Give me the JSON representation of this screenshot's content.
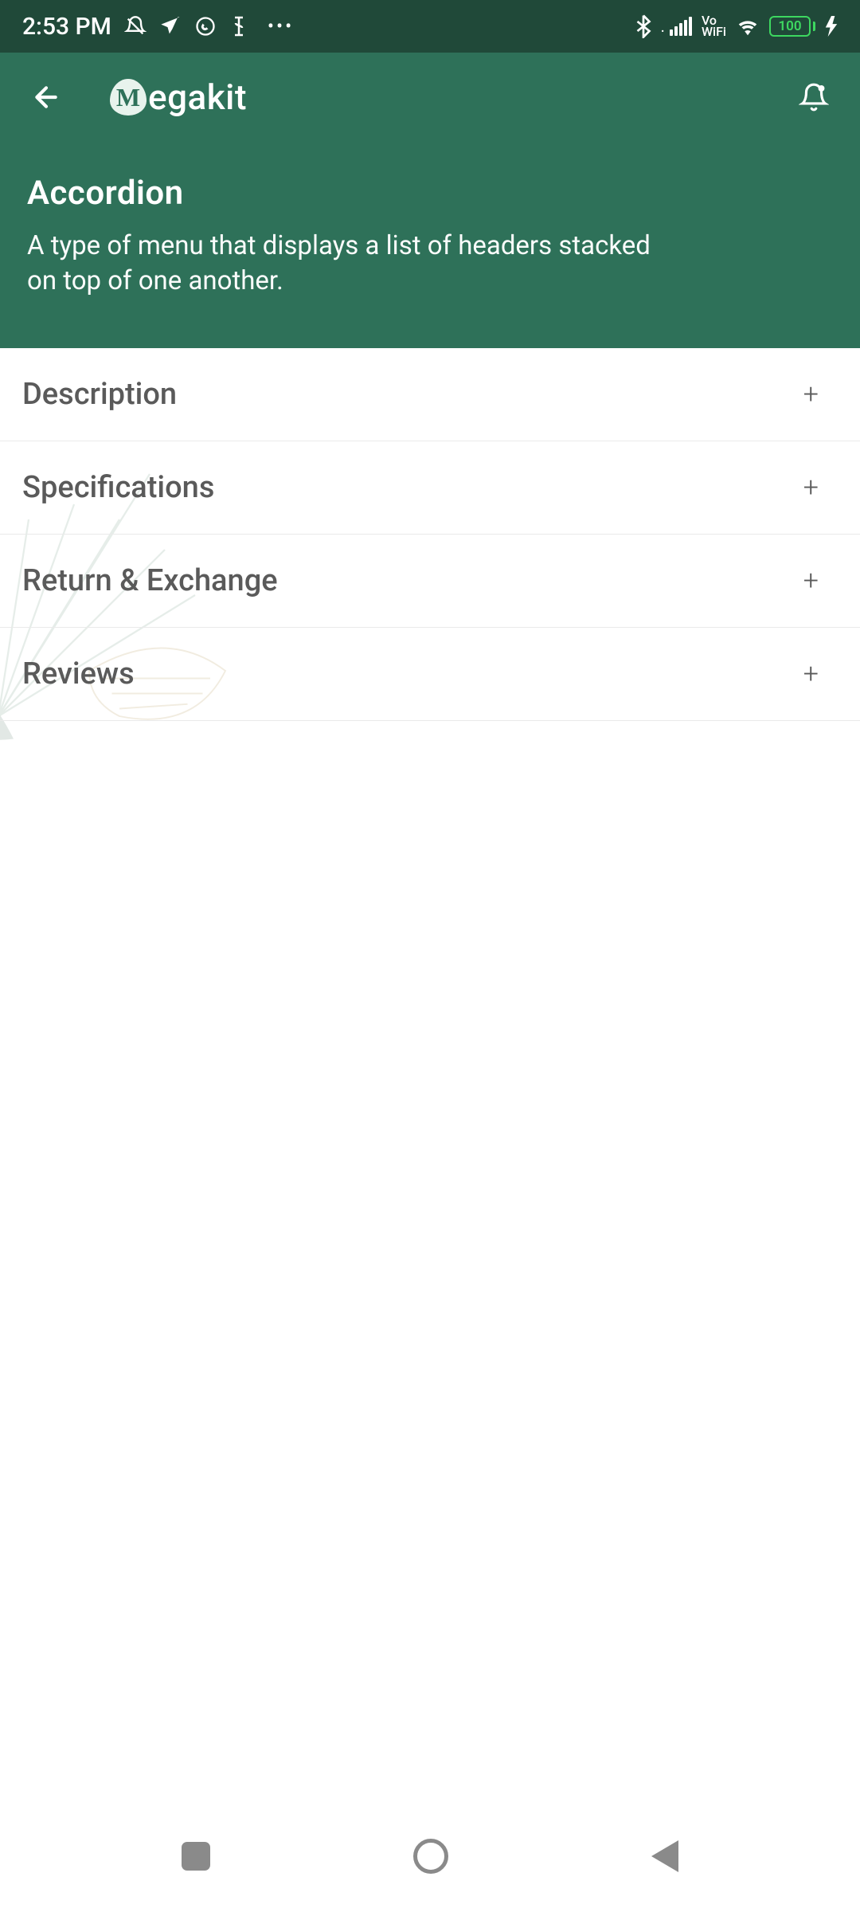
{
  "status": {
    "time": "2:53 PM",
    "battery": "100",
    "network_label": "Vo\nWiFi"
  },
  "header": {
    "app_name": "egakit",
    "logo_letter": "M",
    "title": "Accordion",
    "subtitle": "A type of menu that displays a list of headers stacked on top of one another."
  },
  "accordion": {
    "items": [
      {
        "label": "Description"
      },
      {
        "label": "Specifications"
      },
      {
        "label": "Return & Exchange"
      },
      {
        "label": "Reviews"
      }
    ]
  }
}
